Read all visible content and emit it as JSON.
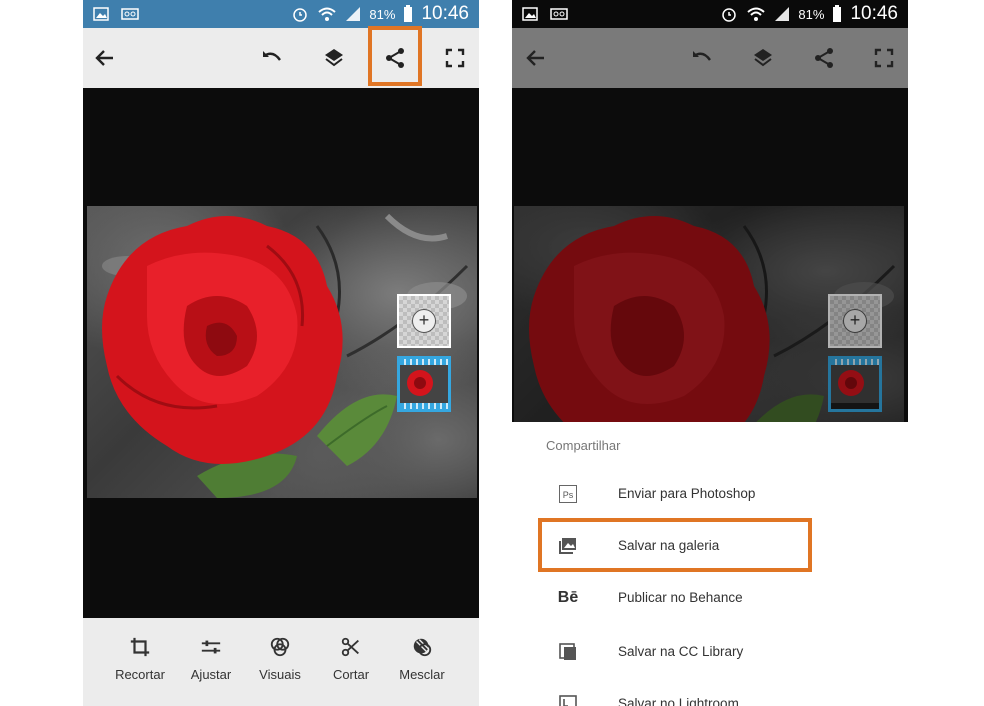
{
  "status_bar": {
    "battery": "81%",
    "time": "10:46"
  },
  "toolbar": {
    "icons": [
      "back-arrow-icon",
      "undo-icon",
      "layers-icon",
      "share-icon",
      "fullscreen-icon"
    ]
  },
  "bottom_tools": [
    {
      "label": "Recortar",
      "icon": "crop-icon"
    },
    {
      "label": "Ajustar",
      "icon": "sliders-icon"
    },
    {
      "label": "Visuais",
      "icon": "looks-icon"
    },
    {
      "label": "Cortar",
      "icon": "scissors-icon"
    },
    {
      "label": "Mesclar",
      "icon": "blend-icon"
    }
  ],
  "share_sheet": {
    "title": "Compartilhar",
    "items": [
      {
        "label": "Enviar para Photoshop",
        "icon": "photoshop-icon"
      },
      {
        "label": "Salvar na galeria",
        "icon": "gallery-icon"
      },
      {
        "label": "Publicar no Behance",
        "icon": "behance-icon"
      },
      {
        "label": "Salvar na CC Library",
        "icon": "library-icon"
      },
      {
        "label": "Salvar no Lightroom",
        "icon": "lightroom-icon"
      }
    ]
  },
  "layer_panel": {
    "add_symbol": "+"
  },
  "colors": {
    "highlight": "#e07524",
    "status_bar_left": "#3f7fad",
    "layer_selected": "#35a7e0",
    "rose_red": "#e01820"
  }
}
